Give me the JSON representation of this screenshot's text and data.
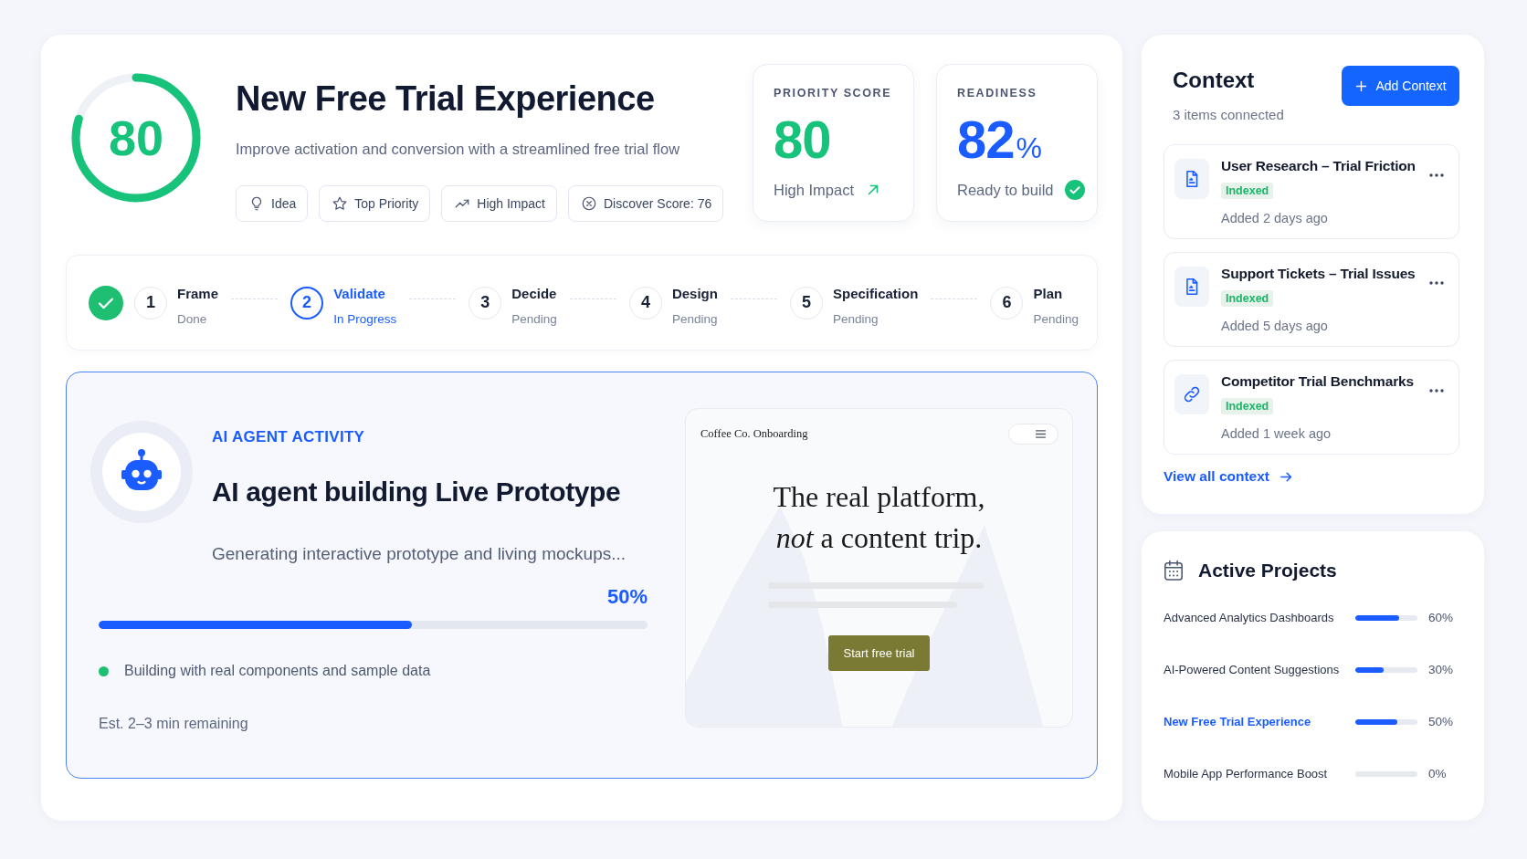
{
  "header": {
    "score_ring": {
      "value": "80",
      "level": 0.8
    },
    "title": "New Free Trial Experience",
    "subtitle": "Improve activation and conversion with a streamlined free trial flow",
    "tags": [
      {
        "kind": "idea",
        "label": "Idea"
      },
      {
        "kind": "priority",
        "label": "Top Priority"
      },
      {
        "kind": "impact",
        "label": "High Impact"
      },
      {
        "kind": "score",
        "label": "Discover Score: 76"
      }
    ]
  },
  "priority_score": {
    "label": "PRIORITY SCORE",
    "value": "80",
    "note": "High Impact"
  },
  "readiness": {
    "label": "READINESS",
    "value": "82",
    "unit": "%",
    "note": "Ready to build"
  },
  "steps": [
    {
      "number": "1",
      "name": "Frame",
      "status": "Done",
      "done": true,
      "current": false
    },
    {
      "number": "2",
      "name": "Validate",
      "status": "In Progress",
      "done": false,
      "current": true
    },
    {
      "number": "3",
      "name": "Decide",
      "status": "Pending",
      "done": false,
      "current": false
    },
    {
      "number": "4",
      "name": "Design",
      "status": "Pending",
      "done": false,
      "current": false
    },
    {
      "number": "5",
      "name": "Specification",
      "status": "Pending",
      "done": false,
      "current": false
    },
    {
      "number": "6",
      "name": "Plan",
      "status": "Pending",
      "done": false,
      "current": false
    }
  ],
  "agent_activity": {
    "eyebrow": "AI AGENT ACTIVITY",
    "title": "AI agent building Live Prototype",
    "subtitle": "Generating interactive prototype and living mockups...",
    "progress": {
      "level": 0.57,
      "reading": "50%"
    },
    "bullet": "Building with real components and sample data",
    "estimate": "Est. 2–3 min remaining",
    "preview": {
      "site_name": "Coffee Co. Onboarding",
      "headline": [
        "The real platform,",
        "*not* a content trip."
      ],
      "cta": "Start free trial"
    }
  },
  "context": {
    "title": "Context",
    "subtitle": "3 items connected",
    "add_button": "Add Context",
    "items": [
      {
        "kind": "document",
        "title": "User Research – Trial Friction",
        "badge": "Indexed",
        "added": "Added 2 days ago"
      },
      {
        "kind": "document",
        "title": "Support Tickets – Trial Issues",
        "badge": "Indexed",
        "added": "Added 5 days ago"
      },
      {
        "kind": "link",
        "title": "Competitor Trial Benchmarks",
        "badge": "Indexed",
        "added": "Added 1 week ago"
      }
    ],
    "view_all": "View all context"
  },
  "active_projects": {
    "title": "Active Projects",
    "projects": [
      {
        "name": "Advanced Analytics Dashboards",
        "level": 0.71,
        "reading": "60%",
        "selected": false
      },
      {
        "name": "AI-Powered Content Suggestions",
        "level": 0.46,
        "reading": "30%",
        "selected": false
      },
      {
        "name": "New Free Trial Experience",
        "level": 0.67,
        "reading": "50%",
        "selected": true
      },
      {
        "name": "Mobile App Performance Boost",
        "level": 0,
        "reading": "0%",
        "selected": false
      }
    ]
  }
}
